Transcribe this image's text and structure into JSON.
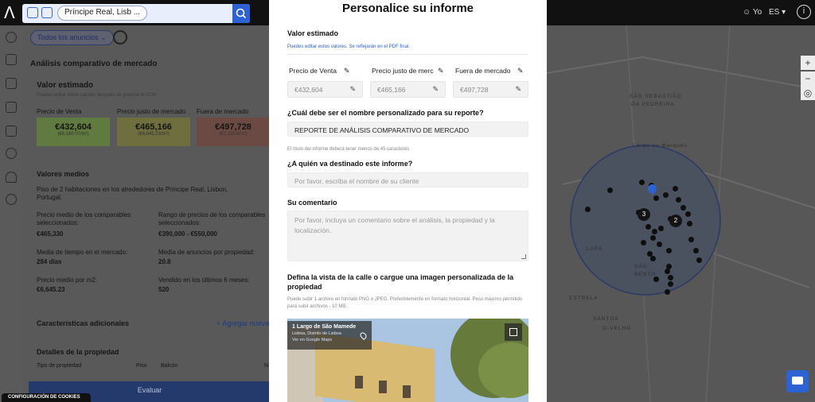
{
  "topbar": {
    "search_chip": "Príncipe Real, Lisb ...",
    "user_label": "Yo",
    "lang_label": "ES ▾",
    "info_label": "i"
  },
  "panel": {
    "filter_label": "Todos los anuncios ⌄",
    "section_title": "Análisis comparativo de mercado",
    "valor_title": "Valor estimado",
    "valor_note": "Puedes editar estos valores después de guardar el ACM",
    "prices": [
      {
        "label": "Precio de Venta",
        "value": "€432,604",
        "sub": "(€6,180.07/m²)",
        "color": "#607a3f"
      },
      {
        "label": "Precio justo de mercado",
        "value": "€465,166",
        "sub": "(€6,645.23/m²)",
        "color": "#6e6e3f"
      },
      {
        "label": "Fuera de mercado",
        "value": "€497,728",
        "sub": "(€7,110.4/m²)",
        "color": "#6a4a42"
      }
    ],
    "valores_title": "Valores medios",
    "desc": "Piso de 2 habitaciones en los alrededores de Príncipe Real, Lisbon, Portugal.",
    "stats": [
      {
        "label": "Precio medio de los comparables seleccionados:",
        "value": "€465,330"
      },
      {
        "label": "Rango de precios de los comparables seleccionados:",
        "value": "€390,000 - €550,000"
      },
      {
        "label": "Media de tiempo en el mercado:",
        "value": "284 días"
      },
      {
        "label": "Media de anuncios por propiedad:",
        "value": "20.8"
      },
      {
        "label": "Precio medio por m2:",
        "value": "€6,645.23"
      },
      {
        "label": "Vendido en los últimos 6 meses:",
        "value": "520"
      }
    ],
    "caracteristicas_title": "Características adicionales",
    "agregar_label": "+ Agregar nueva",
    "detalles_title": "Detalles de la propiedad",
    "tipo_label": "Tipo de propiedad",
    "piso_label": "Piso",
    "balcon_label": "Balcón",
    "n_label": "N",
    "evaluar_label": "Evaluar"
  },
  "modal": {
    "title": "Personalice su informe",
    "valor_heading": "Valor estimado",
    "valor_note": "Puedes editar estos valores. Se reflejarán en el PDF final.",
    "columns": [
      {
        "label": "Precio de Venta",
        "value": "€432,604"
      },
      {
        "label": "Precio justo de mercado",
        "value": "€465,166"
      },
      {
        "label": "Fuera de mercado",
        "value": "€497,728"
      }
    ],
    "name_question": "¿Cuál debe ser el nombre personalizado para su reporte?",
    "name_value": "REPORTE DE ANÁLISIS COMPARATIVO  DE MERCADO",
    "name_help": "El título del informe deberá tener menos de 45 caracteres",
    "recipient_question": "¿A quién va destinado este informe?",
    "recipient_placeholder": "Por favor, escriba el nombre de su cliente",
    "comment_heading": "Su comentario",
    "comment_placeholder": "Por favor, incluya un comentario sobre el análisis, la propiedad y la localización.",
    "street_heading": "Defina la vista de la calle o cargue una imagen personalizada de la propiedad",
    "street_help": "Puede subir 1 archivo en formato PNG o JPEG. Preferiblemente en formato horizontal. Peso máximo permitido para subir archivos - 10 MB.",
    "street_place": "1 Largo de São Mamede",
    "street_region": "Lisboa, Distrito de Lisboa",
    "street_link": "Ver en Google Maps"
  },
  "map": {
    "labels": [
      "SÃO SEBASTIÃO",
      "DA PEDREIRA",
      "Largo do Marquês",
      "LAPA",
      "SÃO",
      "BENTO",
      "ESTRELA",
      "SANTOS",
      "O-VELHO"
    ],
    "cluster_counts": [
      "3",
      "2"
    ]
  },
  "cookies_label": "CONFIGURACIÓN DE COOKIES"
}
